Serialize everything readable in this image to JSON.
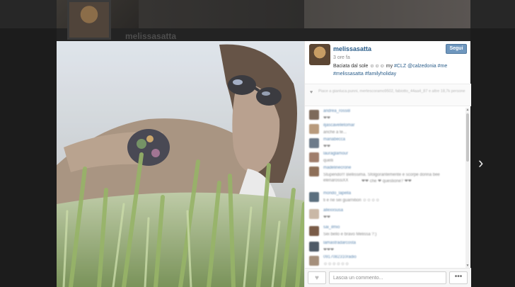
{
  "background": {
    "username": "melissasatta"
  },
  "post": {
    "author": "melissasatta",
    "follow_label": "Segui",
    "time_ago": "3 ore fa",
    "caption_text": "Baciata dal sole ☺☺☺ my ",
    "caption_tags": "#CLZ @calzedonia #me #melissasatta #familyholiday",
    "likes_text": "Piace a gianluca.punni, mertescoramo9502, fabiotto_44aa4_87 e altre 18,7k persone"
  },
  "comments": [
    {
      "user": "andrea_rossi8",
      "text": "❤❤"
    },
    {
      "user": "iljascavelletomar",
      "text": "anche a te..."
    },
    {
      "user": "mariabecca",
      "text": "❤❤"
    },
    {
      "user": "lauraglamour",
      "text": "quelli"
    },
    {
      "user": "madelinecrone",
      "text": "Stupendo!!! Bellissima. Sfolgorantemente e scorpe donna bee"
    },
    {
      "user": "elenarossiXX",
      "text": "❤❤ che ❤ questione? ❤❤"
    },
    {
      "user": "mondo_lapella",
      "text": "ti e ne sei guarnition ☺☺☺☺"
    },
    {
      "user": "allexxsusa",
      "text": "❤❤"
    },
    {
      "user": "sai_ilmio",
      "text": "Sei bello e bravo Melissa ?:)"
    },
    {
      "user": "lamastradarcosta",
      "text": "❤❤❤"
    },
    {
      "user": "0917082310radio",
      "text": "☺☺☺☺☺☺"
    }
  ],
  "footer": {
    "comment_placeholder": "Lascia un commento...",
    "more_label": "•••"
  },
  "icons": {
    "heart": "heart-icon",
    "next": "chevron-right-icon"
  },
  "colors": {
    "link": "#2a5d8a",
    "follow_button": "#6f97be"
  }
}
